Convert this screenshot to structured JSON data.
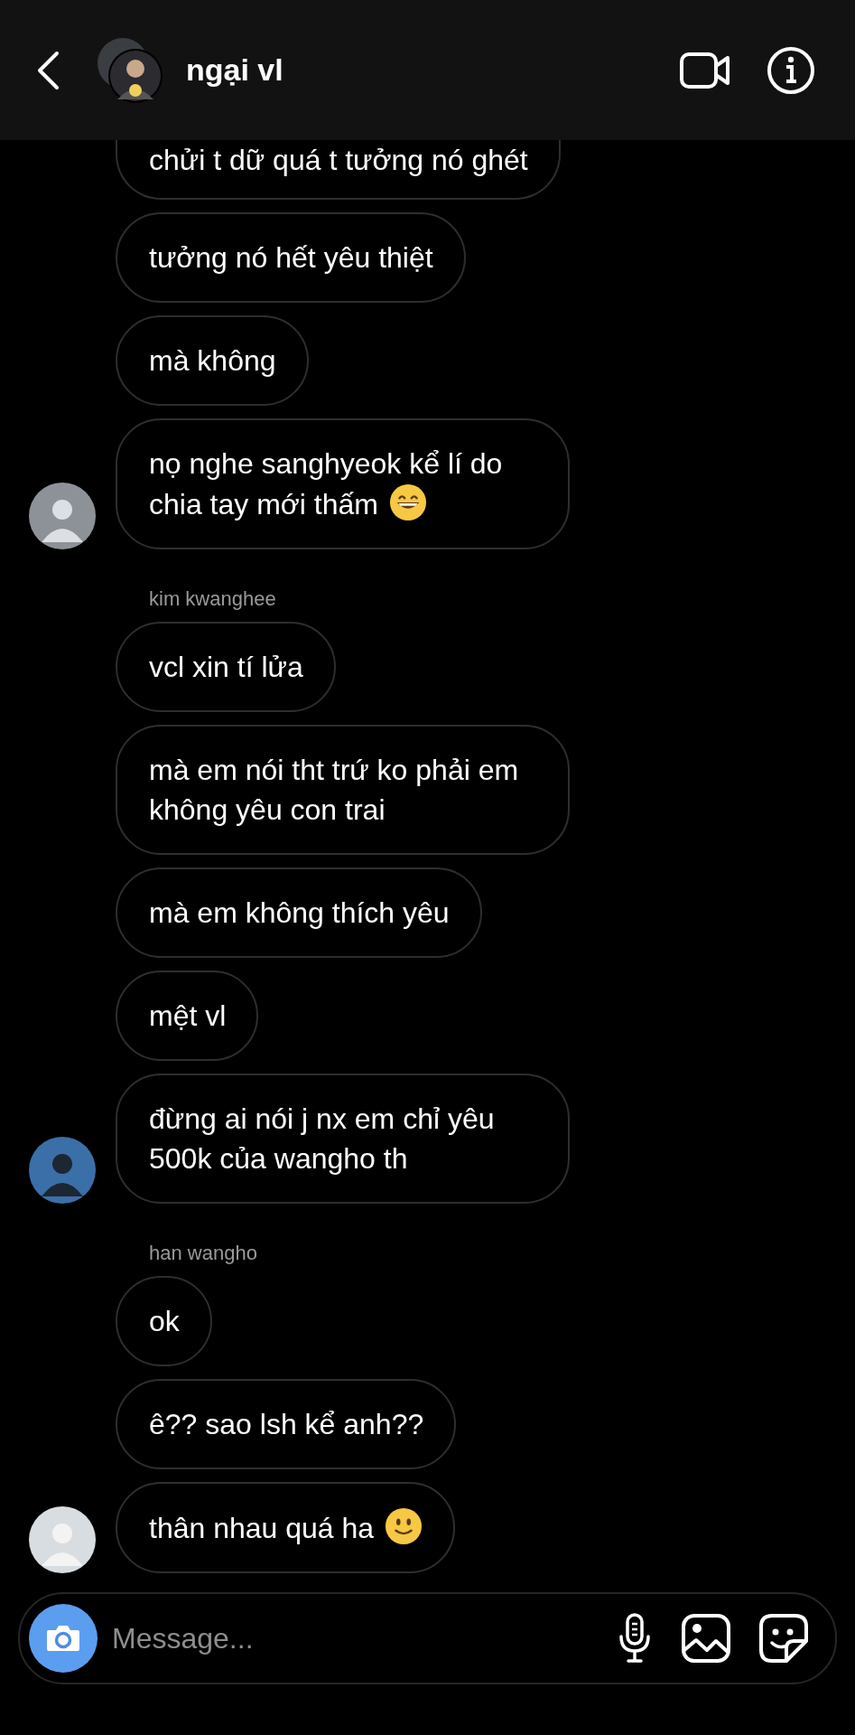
{
  "header": {
    "title": "ngại vl"
  },
  "groups": [
    {
      "messages": [
        {
          "kind": "plain",
          "text": "chửi t dữ quá t tưởng nó ghét",
          "clipped_top": true
        },
        {
          "kind": "plain",
          "text": "tưởng nó hết yêu thiệt"
        },
        {
          "kind": "plain",
          "text": "mà không"
        },
        {
          "kind": "grinning",
          "text": "nọ nghe sanghyeok kể lí do chia tay mới thấm"
        }
      ]
    },
    {
      "sender": "kim kwanghee",
      "messages": [
        {
          "kind": "plain",
          "text": "vcl xin tí lửa"
        },
        {
          "kind": "plain",
          "text": "mà em nói tht trứ ko phải em không yêu con trai"
        },
        {
          "kind": "plain",
          "text": "mà em không thích yêu"
        },
        {
          "kind": "plain",
          "text": "mệt vl"
        },
        {
          "kind": "plain",
          "text": "đừng ai nói j nx em chỉ yêu 500k của wangho th"
        }
      ]
    },
    {
      "sender": "han wangho",
      "messages": [
        {
          "kind": "plain",
          "text": "ok"
        },
        {
          "kind": "plain",
          "text": "ê?? sao lsh kể anh??"
        },
        {
          "kind": "smiling",
          "text": "thân nhau quá ha"
        }
      ]
    }
  ],
  "composer": {
    "placeholder": "Message..."
  }
}
